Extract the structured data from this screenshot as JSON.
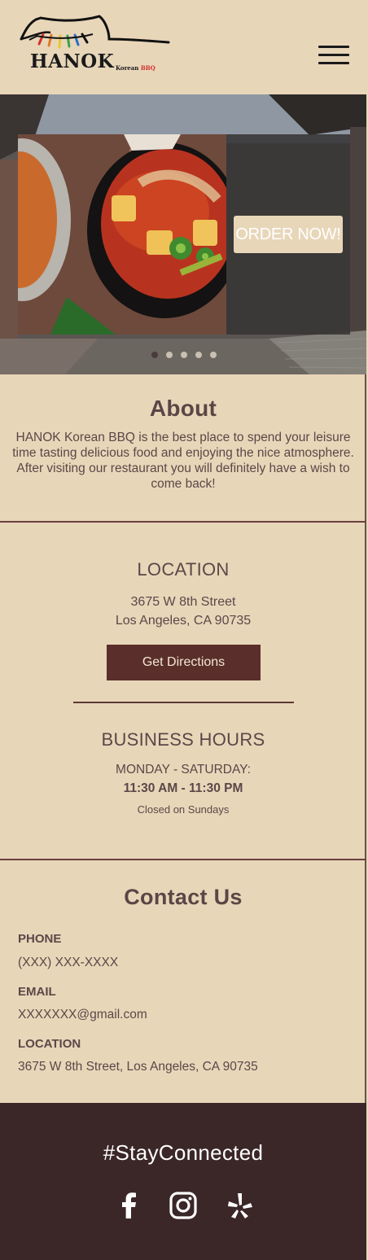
{
  "header": {
    "logo_text": "HANOK",
    "logo_sub_korean": "Korean",
    "logo_sub_bbq": "BBQ",
    "menu_icon": "hamburger-menu-icon"
  },
  "hero": {
    "order_button": "ORDER NOW!",
    "carousel": {
      "slides": 5,
      "active_index": 0
    }
  },
  "about": {
    "title": "About",
    "text": "HANOK Korean BBQ is the best place to spend your leisure time tasting delicious food and enjoying the nice atmosphere. After visiting our restaurant you will definitely have a wish to come back!"
  },
  "location": {
    "title": "LOCATION",
    "address_line1": "3675 W 8th Street",
    "address_line2": "Los Angeles, CA 90735",
    "directions_button": "Get Directions"
  },
  "hours": {
    "title": "BUSINESS HOURS",
    "days": "MONDAY - SATURDAY:",
    "time": "11:30 AM - 11:30 PM",
    "closed": "Closed on Sundays"
  },
  "contact": {
    "title": "Contact Us",
    "phone_label": "PHONE",
    "phone_value": "(XXX) XXX-XXXX",
    "email_label": "EMAIL",
    "email_value": "XXXXXXX@gmail.com",
    "location_label": "LOCATION",
    "location_value": "3675 W 8th Street, Los Angeles, CA 90735"
  },
  "footer": {
    "hashtag": "#StayConnected",
    "social_icons": [
      "facebook-icon",
      "instagram-icon",
      "yelp-icon"
    ]
  },
  "colors": {
    "background": "#e8d6b9",
    "text": "#5a4848",
    "button_dark": "#5a2e2a",
    "footer": "#3b2628"
  }
}
